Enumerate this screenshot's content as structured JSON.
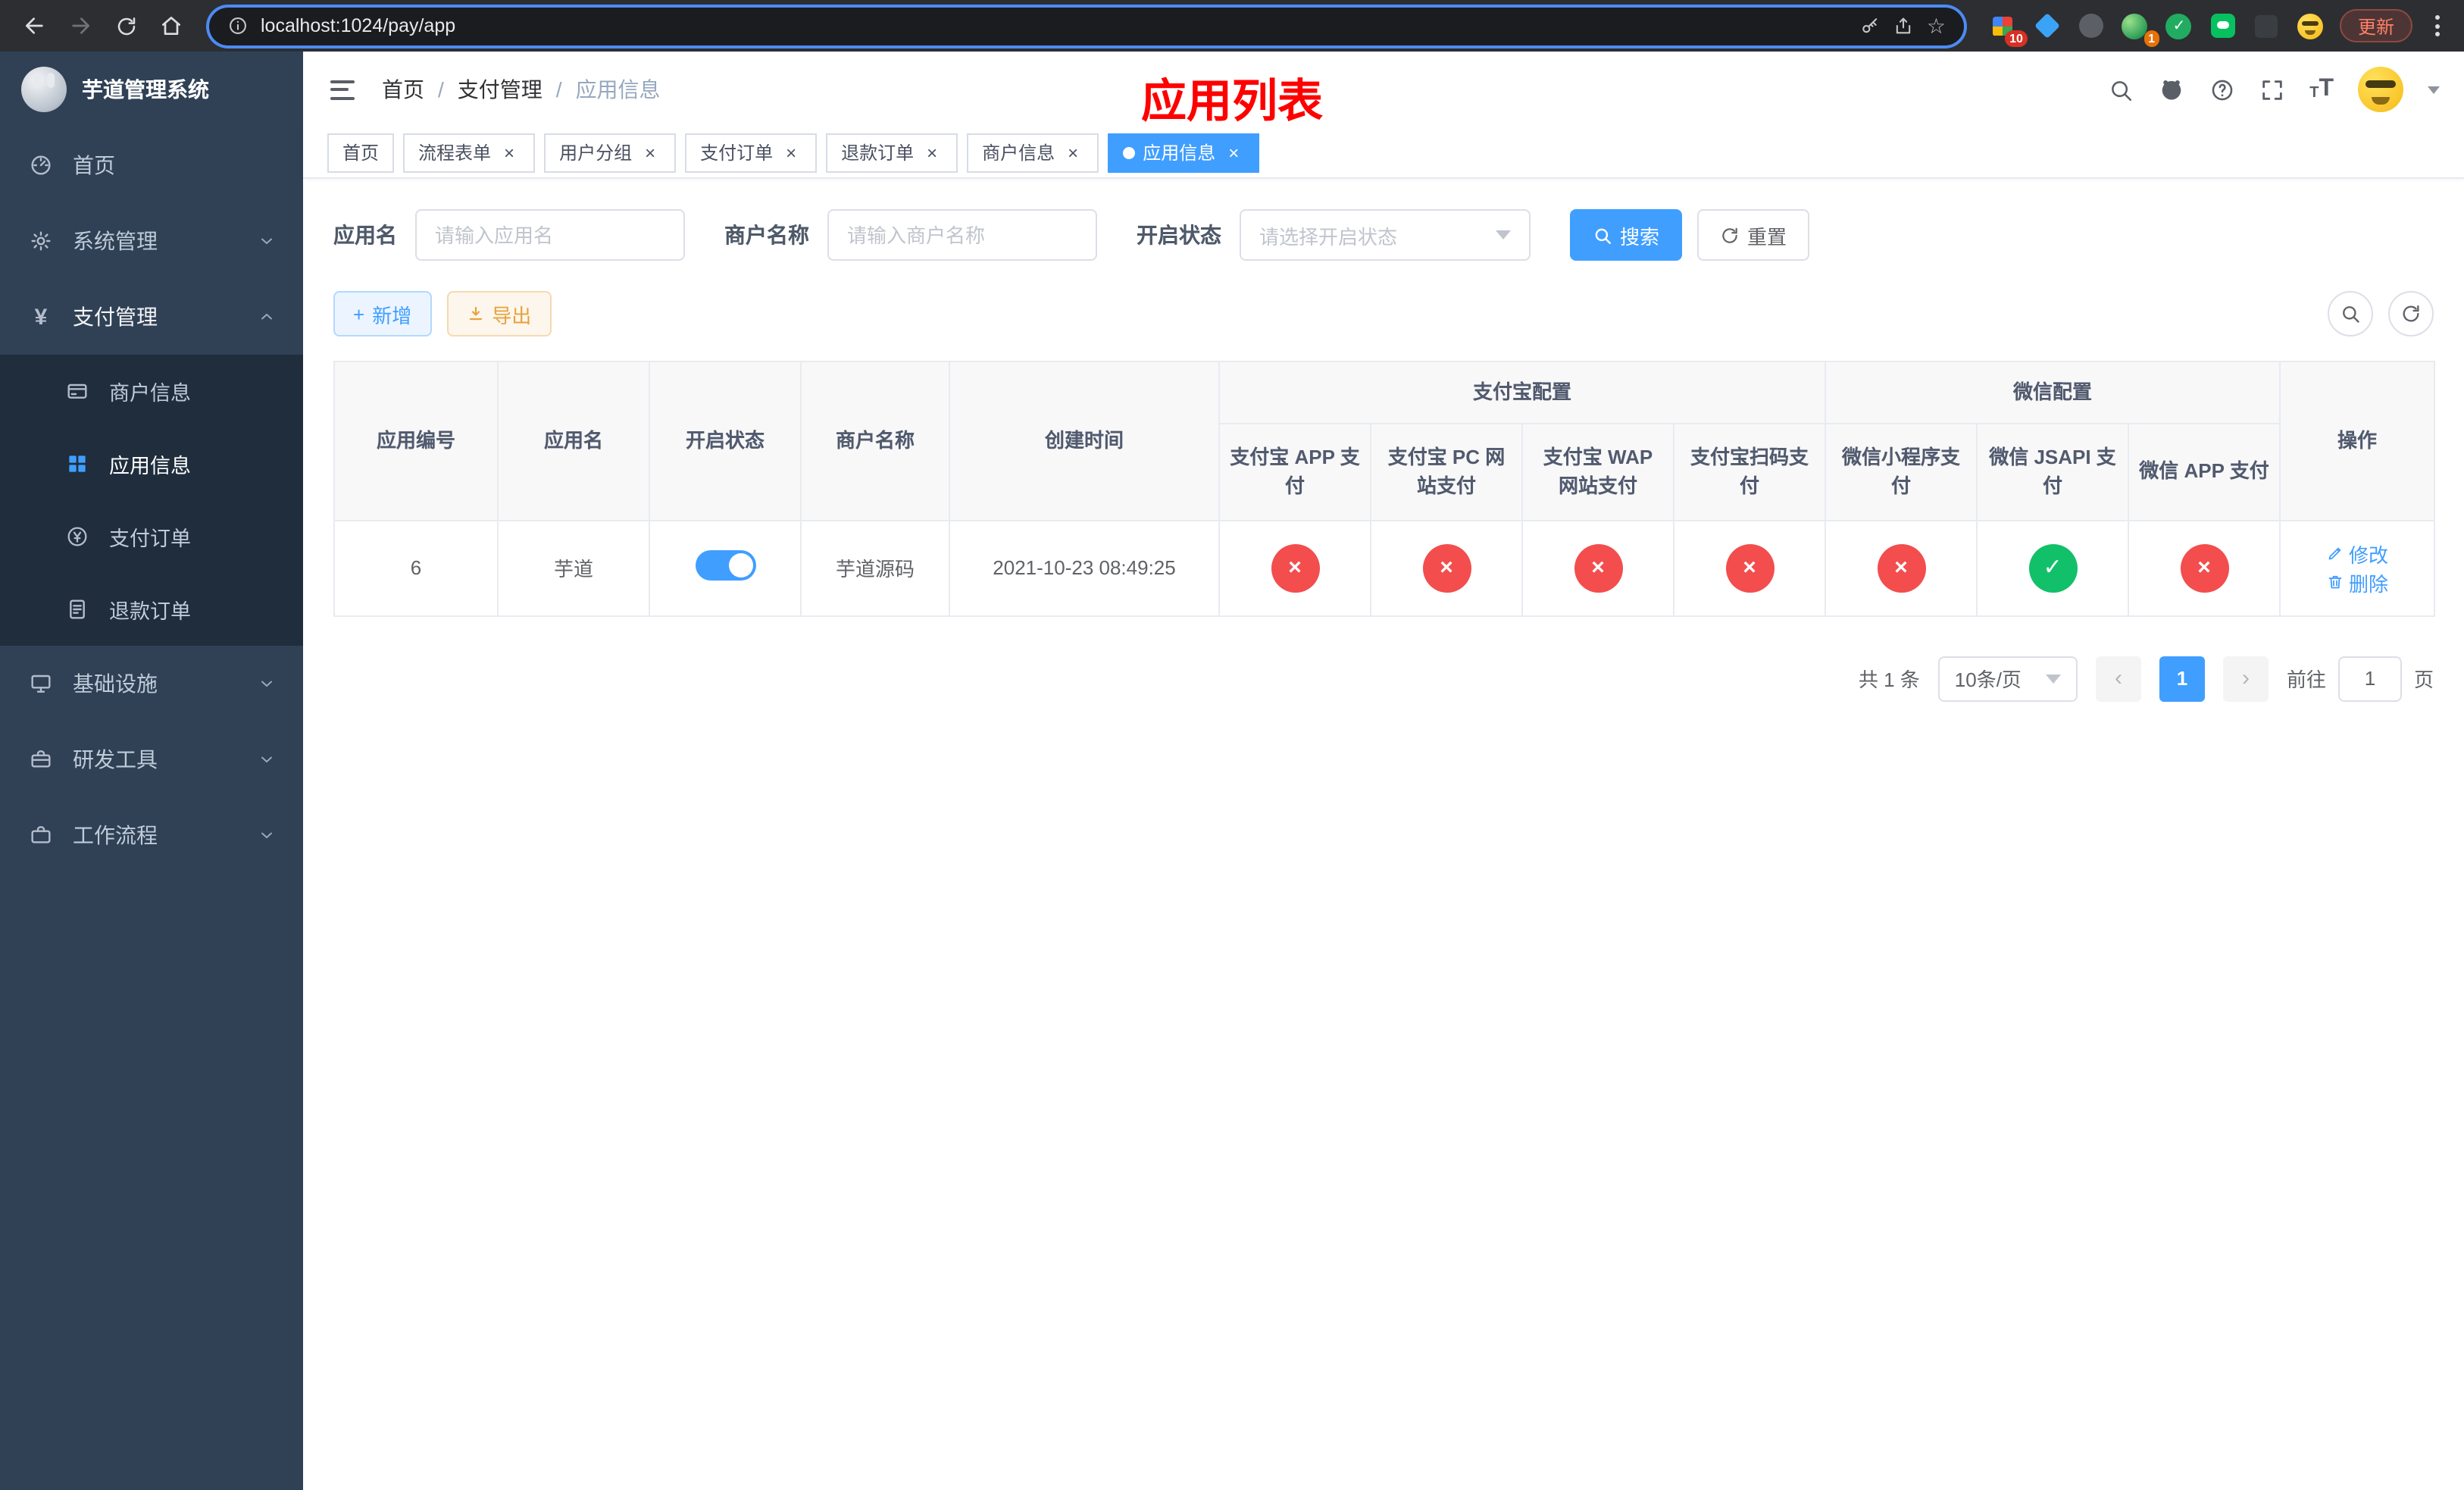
{
  "icons": {
    "close": "×",
    "cross": "×",
    "check": "✓",
    "plus": "+",
    "prev": "‹",
    "next": "›",
    "star": "☆",
    "yen": "¥",
    "font_large": "T",
    "font_small": "T"
  },
  "browser": {
    "url": "localhost:1024/pay/app",
    "update_label": "更新",
    "extension_badge_count": "10",
    "profile_badge_count": "1"
  },
  "sidebar": {
    "title": "芋道管理系统",
    "items": [
      {
        "label": "首页"
      },
      {
        "label": "系统管理"
      },
      {
        "label": "支付管理"
      },
      {
        "label": "商户信息"
      },
      {
        "label": "应用信息"
      },
      {
        "label": "支付订单"
      },
      {
        "label": "退款订单"
      },
      {
        "label": "基础设施"
      },
      {
        "label": "研发工具"
      },
      {
        "label": "工作流程"
      }
    ]
  },
  "header": {
    "breadcrumb": [
      "首页",
      "支付管理",
      "应用信息"
    ],
    "annotation": "应用列表"
  },
  "tabs": [
    {
      "label": "首页"
    },
    {
      "label": "流程表单"
    },
    {
      "label": "用户分组"
    },
    {
      "label": "支付订单"
    },
    {
      "label": "退款订单"
    },
    {
      "label": "商户信息"
    },
    {
      "label": "应用信息"
    }
  ],
  "filters": {
    "app_name": {
      "label": "应用名",
      "placeholder": "请输入应用名"
    },
    "merchant_name": {
      "label": "商户名称",
      "placeholder": "请输入商户名称"
    },
    "status": {
      "label": "开启状态",
      "placeholder": "请选择开启状态"
    },
    "search_label": "搜索",
    "reset_label": "重置"
  },
  "toolbar": {
    "add_label": "新增",
    "export_label": "导出"
  },
  "table": {
    "headers": {
      "app_id": "应用编号",
      "app_name": "应用名",
      "status": "开启状态",
      "merchant": "商户名称",
      "created": "创建时间",
      "alipay_group": "支付宝配置",
      "wechat_group": "微信配置",
      "alipay_app": "支付宝 APP 支付",
      "alipay_pc": "支付宝 PC 网站支付",
      "alipay_wap": "支付宝 WAP 网站支付",
      "alipay_qr": "支付宝扫码支付",
      "wechat_mini": "微信小程序支付",
      "wechat_jsapi": "微信 JSAPI 支付",
      "wechat_app": "微信 APP 支付",
      "actions": "操作"
    },
    "rows": [
      {
        "app_id": "6",
        "app_name": "芋道",
        "status": "on",
        "merchant": "芋道源码",
        "created": "2021-10-23 08:49:25",
        "alipay_app": "disabled",
        "alipay_pc": "disabled",
        "alipay_wap": "disabled",
        "alipay_qr": "disabled",
        "wechat_mini": "disabled",
        "wechat_jsapi": "enabled",
        "wechat_app": "disabled",
        "edit_label": "修改",
        "delete_label": "删除"
      }
    ]
  },
  "pagination": {
    "total": "共 1 条",
    "page_size": "10条/页",
    "current_page": "1",
    "goto_prefix": "前往",
    "goto_value": "1",
    "goto_suffix": "页"
  }
}
